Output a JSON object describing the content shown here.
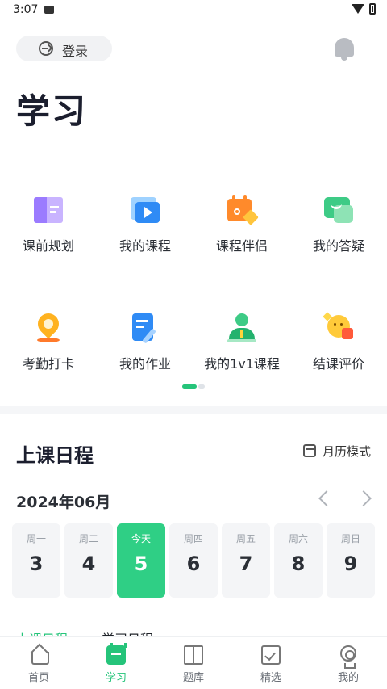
{
  "status_bar": {
    "time": "3:07",
    "icons": [
      "image-icon",
      "wifi-icon",
      "battery-icon"
    ]
  },
  "header": {
    "login_label": "登录",
    "bell_icon": "bell-icon",
    "title": "学习"
  },
  "features": [
    {
      "label": "课前规划",
      "icon": "book-icon",
      "color": "#9b7bff"
    },
    {
      "label": "我的课程",
      "icon": "video-icon",
      "color": "#2f8bf5"
    },
    {
      "label": "课程伴侣",
      "icon": "calendar-star-icon",
      "color": "#ff8a2b"
    },
    {
      "label": "我的答疑",
      "icon": "chat-icon",
      "color": "#3ecb86"
    },
    {
      "label": "考勤打卡",
      "icon": "location-pin-icon",
      "color": "#ffb21f"
    },
    {
      "label": "我的作业",
      "icon": "homework-icon",
      "color": "#2f8bf5"
    },
    {
      "label": "我的1v1课程",
      "icon": "teacher-icon",
      "color": "#23b26d"
    },
    {
      "label": "结课评价",
      "icon": "rating-icon",
      "color": "#ffca3a"
    }
  ],
  "pager": {
    "pages": 2,
    "current": 1
  },
  "schedule": {
    "title": "上课日程",
    "calendar_mode_label": "月历模式",
    "month": "2024年06月",
    "days": [
      {
        "weekday": "周一",
        "date": "3",
        "today": false
      },
      {
        "weekday": "周二",
        "date": "4",
        "today": false
      },
      {
        "weekday": "今天",
        "date": "5",
        "today": true
      },
      {
        "weekday": "周四",
        "date": "6",
        "today": false
      },
      {
        "weekday": "周五",
        "date": "7",
        "today": false
      },
      {
        "weekday": "周六",
        "date": "8",
        "today": false
      },
      {
        "weekday": "周日",
        "date": "9",
        "today": false
      }
    ],
    "subtabs": [
      "上课日程",
      "学习日程"
    ]
  },
  "bottom_nav": [
    {
      "label": "首页",
      "icon": "home-icon",
      "active": false
    },
    {
      "label": "学习",
      "icon": "study-icon",
      "active": true
    },
    {
      "label": "题库",
      "icon": "book-open-icon",
      "active": false
    },
    {
      "label": "精选",
      "icon": "checkbox-icon",
      "active": false
    },
    {
      "label": "我的",
      "icon": "profile-icon",
      "active": false
    }
  ],
  "colors": {
    "accent": "#25c47a",
    "today_bg": "#2fcf85",
    "title": "#1b1e2e"
  }
}
